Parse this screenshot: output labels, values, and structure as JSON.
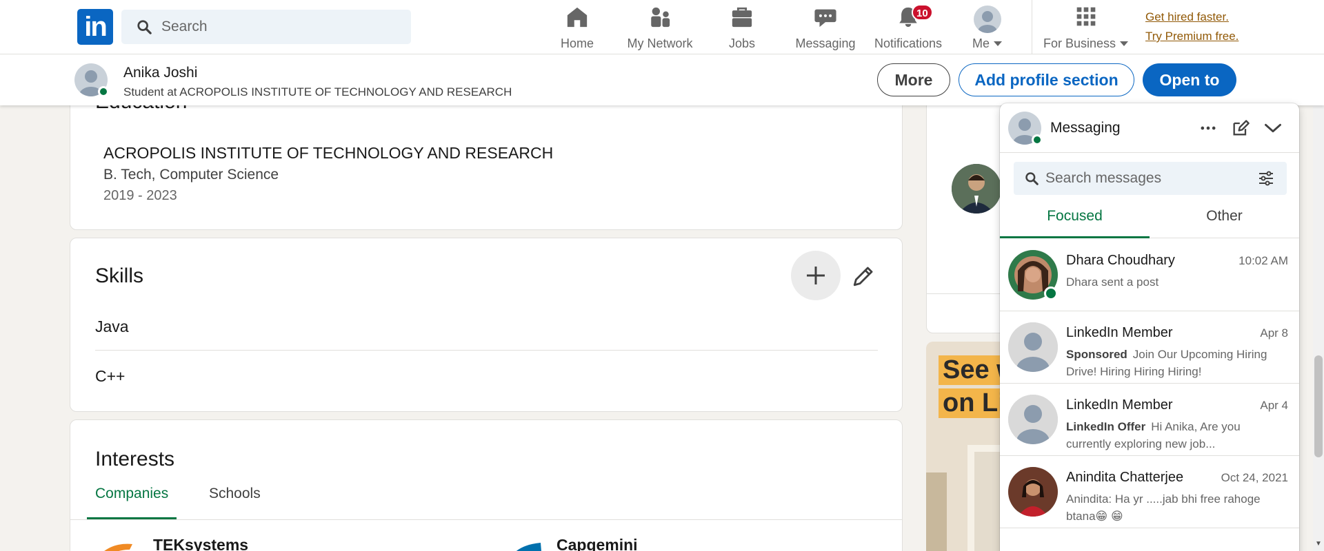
{
  "nav": {
    "logo": "in",
    "search_placeholder": "Search",
    "items": [
      {
        "label": "Home"
      },
      {
        "label": "My Network"
      },
      {
        "label": "Jobs"
      },
      {
        "label": "Messaging"
      },
      {
        "label": "Notifications",
        "badge": "10"
      },
      {
        "label": "Me"
      },
      {
        "label": "For Business"
      }
    ],
    "premium_line1": "Get hired faster.",
    "premium_line2": "Try Premium free."
  },
  "profile_bar": {
    "name": "Anika Joshi",
    "headline": "Student at ACROPOLIS INSTITUTE OF TECHNOLOGY AND RESEARCH",
    "more_label": "More",
    "add_section_label": "Add profile section",
    "open_to_label": "Open to"
  },
  "education": {
    "title": "Education",
    "school": "ACROPOLIS INSTITUTE OF TECHNOLOGY AND RESEARCH",
    "degree": "B. Tech, Computer Science",
    "dates": "2019 - 2023"
  },
  "skills": {
    "title": "Skills",
    "items": [
      "Java",
      "C++"
    ]
  },
  "interests": {
    "title": "Interests",
    "tabs": [
      "Companies",
      "Schools"
    ],
    "companies": [
      "TEKsystems",
      "Capgemini"
    ]
  },
  "ad": {
    "line1": "See w",
    "line2": "on Li"
  },
  "messaging": {
    "title": "Messaging",
    "search_placeholder": "Search messages",
    "tabs": [
      "Focused",
      "Other"
    ],
    "conversations": [
      {
        "name": "Dhara Choudhary",
        "time": "10:02 AM",
        "tag": "",
        "snippet": "Dhara sent a post"
      },
      {
        "name": "LinkedIn Member",
        "time": "Apr 8",
        "tag": "Sponsored",
        "snippet": "Join Our Upcoming Hiring Drive! Hiring Hiring Hiring!"
      },
      {
        "name": "LinkedIn Member",
        "time": "Apr 4",
        "tag": "LinkedIn Offer",
        "snippet": "Hi Anika, Are you currently exploring new job..."
      },
      {
        "name": "Anindita Chatterjee",
        "time": "Oct 24, 2021",
        "tag": "",
        "snippet": "Anindita: Ha yr .....jab bhi free rahoge btana😁 😁"
      }
    ]
  },
  "colors": {
    "brand": "#0a66c2",
    "accent_green": "#057642",
    "badge_red": "#cb112d",
    "premium": "#915907"
  }
}
